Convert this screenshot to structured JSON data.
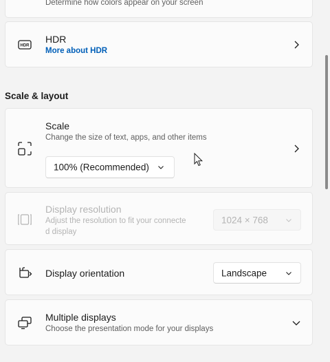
{
  "color_profile": {
    "desc": "Determine how colors appear on your screen"
  },
  "hdr": {
    "icon": "hdr-icon",
    "title": "HDR",
    "link": "More about HDR"
  },
  "section": {
    "heading": "Scale & layout"
  },
  "scale": {
    "icon": "scale-icon",
    "title": "Scale",
    "desc": "Change the size of text, apps, and other items",
    "value": "100% (Recommended)"
  },
  "resolution": {
    "icon": "resolution-icon",
    "title": "Display resolution",
    "desc_line1": "Adjust the resolution to fit your connecte",
    "desc_line2": "d display",
    "value": "1024 × 768",
    "state": "disabled"
  },
  "orientation": {
    "icon": "orientation-icon",
    "title": "Display orientation",
    "value": "Landscape"
  },
  "multiple_displays": {
    "icon": "multiple-displays-icon",
    "title": "Multiple displays",
    "desc": "Choose the presentation mode for your displays"
  },
  "colors": {
    "accent_link": "#005fb8",
    "background": "#f3f3f3",
    "card": "#fbfbfb",
    "disabled_text": "#b4b4b4"
  }
}
